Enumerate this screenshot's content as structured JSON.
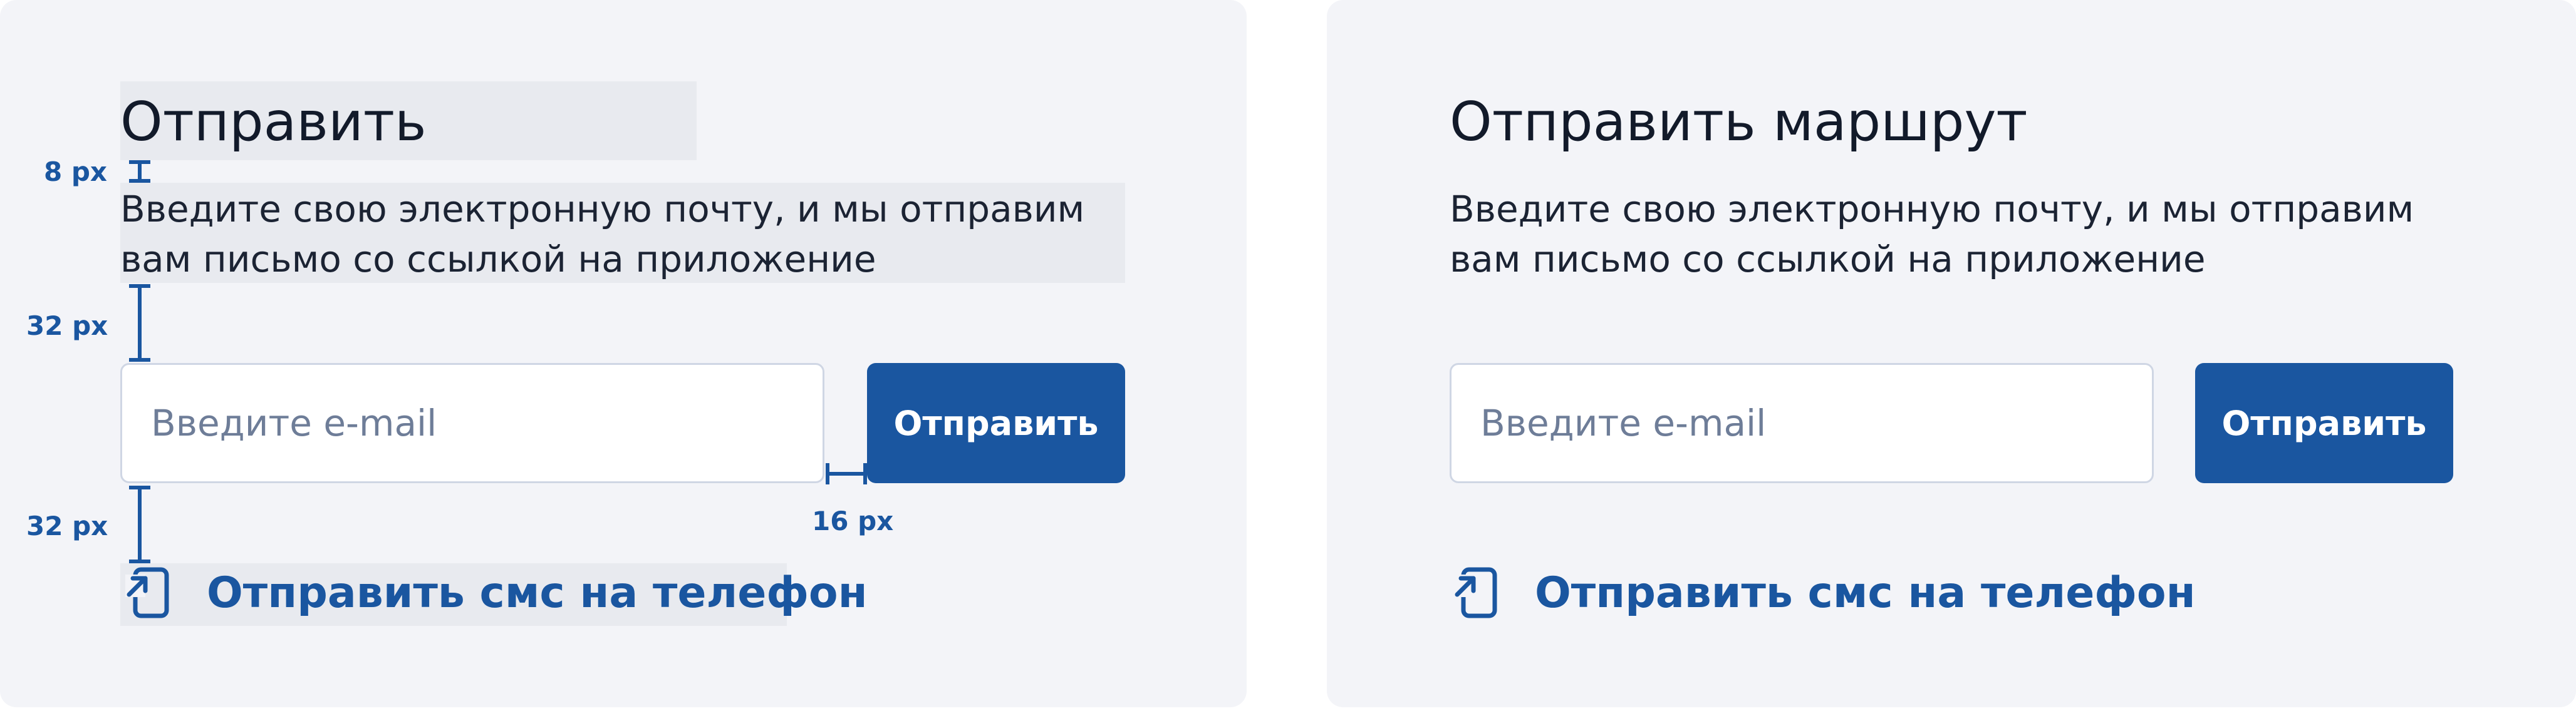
{
  "left_panel": {
    "title": "Отправить",
    "description_line1": "Введите свою электронную почту, и мы отправим",
    "description_line2": "вам письмо со ссылкой на приложение",
    "email_placeholder": "Введите e-mail",
    "send_button": "Отправить",
    "sms_link": "Отправить смс на телефон",
    "sms_icon": "phone-arrow-icon"
  },
  "right_panel": {
    "title": "Отправить маршрут",
    "description_line1": "Введите свою электронную почту, и мы отправим",
    "description_line2": "вам письмо со ссылкой на приложение",
    "email_placeholder": "Введите e-mail",
    "send_button": "Отправить",
    "sms_link": "Отправить смс на телефон",
    "sms_icon": "phone-arrow-icon"
  },
  "annotations": {
    "gap_title_description": "8 px",
    "gap_description_input": "32 px",
    "gap_input_button": "16 px",
    "gap_input_link": "32 px"
  },
  "colors": {
    "accent": "#1a56a0",
    "panel_background": "#f3f4f8",
    "highlight": "#e8eaef",
    "text": "#121a2a",
    "input_border": "#cfd6e4",
    "placeholder": "#6e7d98"
  }
}
